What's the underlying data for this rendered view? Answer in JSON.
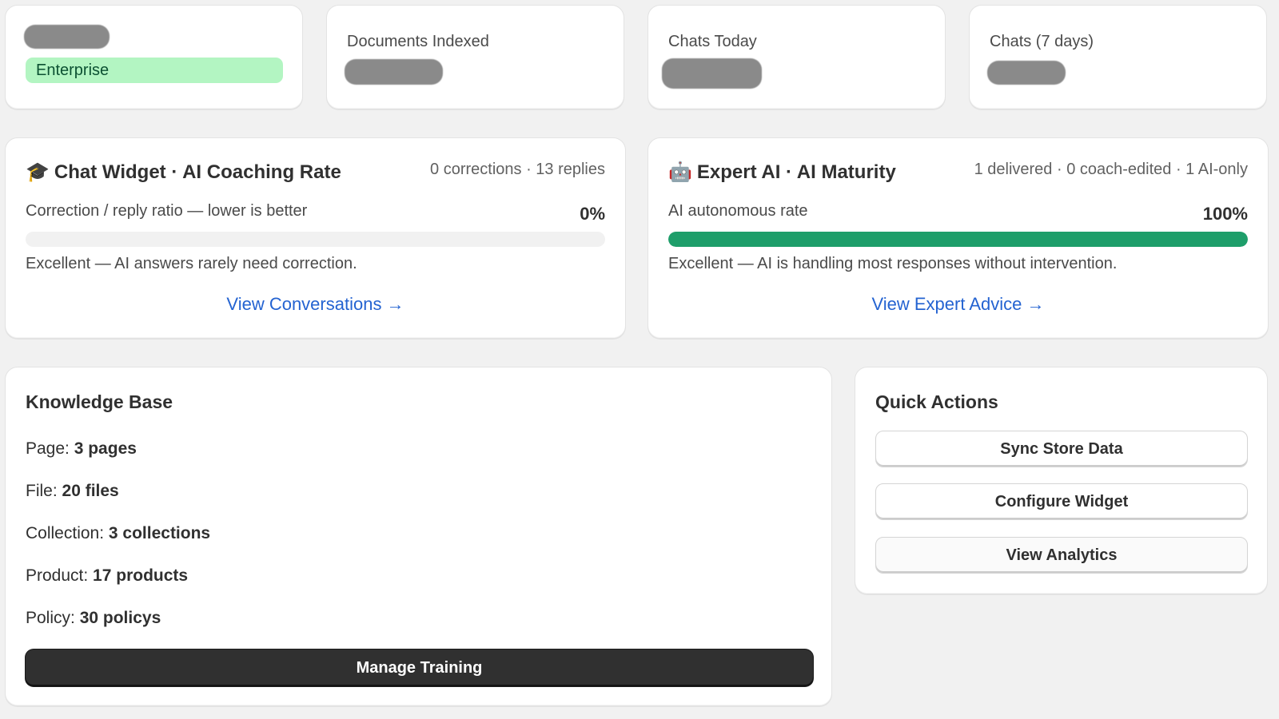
{
  "stats": {
    "plan_badge": "Enterprise",
    "documents_label": "Documents Indexed",
    "chats_today_label": "Chats Today",
    "chats_week_label": "Chats (7 days)"
  },
  "coaching": {
    "icon": "🎓",
    "title": "Chat Widget · AI Coaching Rate",
    "meta": "0 corrections · 13 replies",
    "subtitle": "Correction / reply ratio — lower is better",
    "percent_label": "0%",
    "progress": 0,
    "note": "Excellent — AI answers rarely need correction.",
    "link": "View Conversations →"
  },
  "maturity": {
    "icon": "🤖",
    "title": "Expert AI · AI Maturity",
    "meta": "1 delivered · 0 coach-edited · 1 AI-only",
    "subtitle": "AI autonomous rate",
    "percent_label": "100%",
    "progress": 1.0,
    "note": "Excellent — AI is handling most responses without intervention.",
    "link": "View Expert Advice →"
  },
  "knowledge_base": {
    "title": "Knowledge Base",
    "rows": [
      {
        "label": "Page: ",
        "value": "3 pages"
      },
      {
        "label": "File: ",
        "value": "20 files"
      },
      {
        "label": "Collection: ",
        "value": "3 collections"
      },
      {
        "label": "Product: ",
        "value": "17 products"
      },
      {
        "label": "Policy: ",
        "value": "30 policys"
      }
    ],
    "button": "Manage Training"
  },
  "quick_actions": {
    "title": "Quick Actions",
    "buttons": [
      "Sync Store Data",
      "Configure Widget",
      "View Analytics"
    ]
  },
  "colors": {
    "accent_green": "#1e9e6a",
    "badge_green": "#b3f5c2",
    "link_blue": "#2463d1",
    "primary_button": "#303030"
  }
}
